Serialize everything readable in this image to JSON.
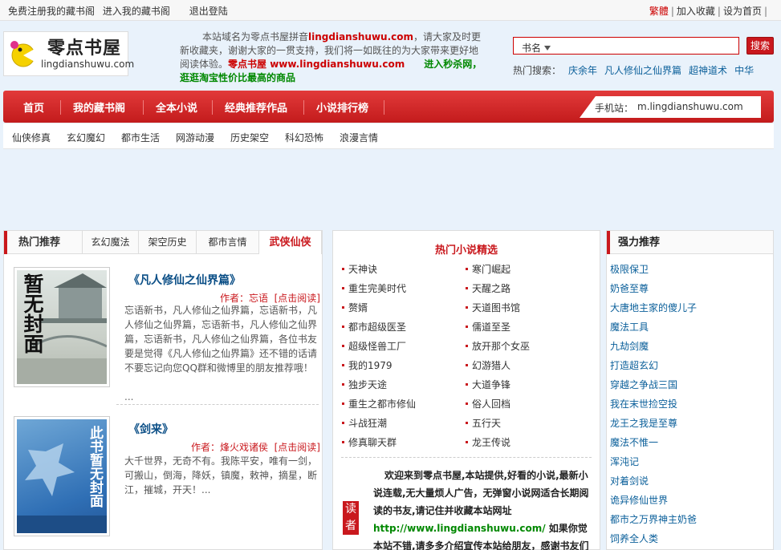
{
  "topbar": {
    "register": "免费注册我的藏书阁",
    "enter": "进入我的藏书阁",
    "logout": "退出登陆",
    "traditional": "繁體",
    "favorite": "加入收藏",
    "homepage": "设为首页",
    "sep": "|"
  },
  "logo": {
    "cn": "零点书屋",
    "en": "lingdianshuwu.com"
  },
  "notice": {
    "p1": "本站域名为零点书屋拼音",
    "domain": "lingdianshuwu.com",
    "p2": "，请大家及时更新收藏夹，谢谢大家的一贯支持，我们将一如既往的为大家带来更好地阅读体验。",
    "site": "零点书屋 www.lingdianshuwu.com",
    "promo": "进入秒杀网，逛逛淘宝性价比最高的商品"
  },
  "search": {
    "select": "书名",
    "placeholder": "",
    "button": "搜索"
  },
  "hot_search": {
    "label": "热门搜索：",
    "keywords": [
      "庆余年",
      "凡人修仙之仙界篇",
      "超神道术",
      "中华"
    ]
  },
  "main_nav": [
    "首页",
    "我的藏书阁",
    "全本小说",
    "经典推荐作品",
    "小说排行榜"
  ],
  "mobile": {
    "label": "手机站：",
    "url": "m.lingdianshuwu.com"
  },
  "sub_nav": [
    "仙侠修真",
    "玄幻魔幻",
    "都市生活",
    "网游动漫",
    "历史架空",
    "科幻恐怖",
    "浪漫言情"
  ],
  "left_panel": {
    "tabs": [
      "热门推荐",
      "玄幻魔法",
      "架空历史",
      "都市言情",
      "武侠仙侠"
    ],
    "books": [
      {
        "cover_text": "暂无封面",
        "title": "《凡人修仙之仙界篇》",
        "author": "作者：忘语",
        "read": "[点击阅读]",
        "desc": "忘语新书，凡人修仙之仙界篇，忘语新书，凡人修仙之仙界篇，忘语新书，凡人修仙之仙界篇，忘语新书，凡人修仙之仙界篇，各位书友要是觉得《凡人修仙之仙界篇》还不错的话请不要忘记向您QQ群和微博里的朋友推荐哦！",
        "more": "..."
      },
      {
        "cover_text": "此书暂无封面",
        "title": "《剑来》",
        "author": "作者：烽火戏诸侯",
        "read": "[点击阅读]",
        "desc": "大千世界，无奇不有。我陈平安，唯有一剑，可搬山，倒海，降妖，镇魔，敕神，摘星，断江，摧城，开天！..."
      }
    ]
  },
  "mid_panel": {
    "title": "热门小说精选",
    "col1": [
      "天神诀",
      "重生完美时代",
      "赘婿",
      "都市超级医圣",
      "超级怪兽工厂",
      "我的1979",
      "独步天途",
      "重生之都市修仙",
      "斗战狂潮",
      "修真聊天群"
    ],
    "col2": [
      "寒门崛起",
      "天醒之路",
      "天道图书馆",
      "儒道至圣",
      "放开那个女巫",
      "幻游猎人",
      "大道争锋",
      "俗人回档",
      "五行天",
      "龙王传说"
    ],
    "reader": "读者",
    "welcome1": "欢迎来到零点书屋,本站提供,好看的小说,最新小说连载,无大量烦人广告，无弹窗小说网适合长期阅读的书友,请记住并收藏本站网址",
    "welcome_url": "http://www.lingdianshuwu.com/",
    "welcome2": " 如果你觉本站不错,请多多介绍宣传本站给朋友，感谢书友们的"
  },
  "right_panel": {
    "title": "强力推荐",
    "items": [
      "极限保卫",
      "奶爸至尊",
      "大唐地主家的傻儿子",
      "魔法工具",
      "九劫剑魔",
      "打造超玄幻",
      "穿越之争战三国",
      "我在末世捡空投",
      "龙王之我是至尊",
      "魔法不惟一",
      "浑沌记",
      "对着剑说",
      "诡异修仙世界",
      "都市之万界神主奶爸",
      "饲养全人类"
    ]
  }
}
